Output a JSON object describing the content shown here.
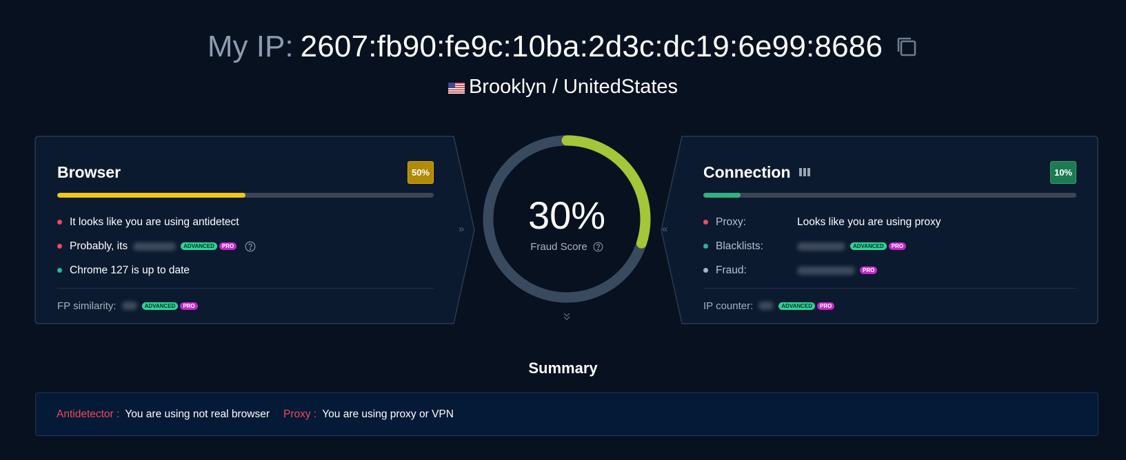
{
  "header": {
    "ip_label": "My IP:",
    "ip_value": "2607:fb90:fe9c:10ba:2d3c:dc19:6e99:8686",
    "copy_icon": "copy-icon",
    "location": "Brooklyn / UnitedStates",
    "flag_icon": "us-flag-icon"
  },
  "browser": {
    "title": "Browser",
    "badge": "50%",
    "score": 0.5,
    "bar_color": "#f5c518",
    "items": [
      {
        "text": "It looks like you are using antidetect",
        "status": "red"
      },
      {
        "text": "Probably, its",
        "status": "red",
        "tags": [
          "ADVANCED",
          "PRO"
        ]
      },
      {
        "text": "Chrome 127 is up to date",
        "status": "teal"
      }
    ],
    "footer_label": "FP similarity:",
    "footer_tags": [
      "ADVANCED",
      "PRO"
    ]
  },
  "gauge": {
    "value": "30%",
    "fraction": 0.3,
    "label": "Fraud Score",
    "arc_color": "#a4c639",
    "track_color": "#3a4a5e"
  },
  "connection": {
    "title": "Connection",
    "badge": "10%",
    "score": 0.1,
    "bar_color": "#2fb37e",
    "items": [
      {
        "label": "Proxy:",
        "value": "Looks like you are using proxy",
        "status": "red"
      },
      {
        "label": "Blacklists:",
        "status": "teal",
        "tags": [
          "ADVANCED",
          "PRO"
        ]
      },
      {
        "label": "Fraud:",
        "status": "gray",
        "tags": [
          "PRO"
        ]
      }
    ],
    "footer_label": "IP counter:",
    "footer_tags": [
      "ADVANCED",
      "PRO"
    ]
  },
  "summary": {
    "title": "Summary",
    "items": [
      {
        "label": "Antidetector :",
        "text": "You are using not real browser"
      },
      {
        "label": "Proxy :",
        "text": "You are using proxy or VPN"
      }
    ]
  }
}
